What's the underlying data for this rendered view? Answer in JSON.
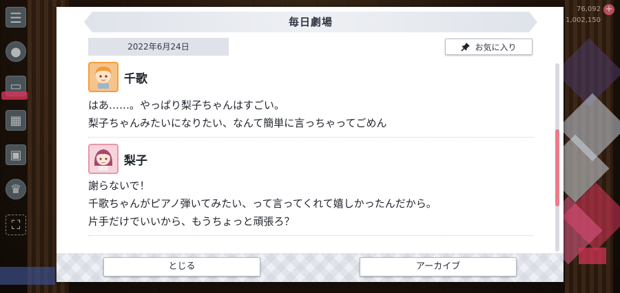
{
  "background": {
    "currency_top": "76,092",
    "currency_bottom": "1,002,150"
  },
  "dialog": {
    "title": "毎日劇場",
    "date": "2022年6月24日",
    "favorite_label": "お気に入り",
    "entries": [
      {
        "speaker": "千歌",
        "avatar": "chika-avatar-icon",
        "lines": [
          "はあ……。やっぱり梨子ちゃんはすごい。",
          "梨子ちゃんみたいになりたい、なんて簡単に言っちゃってごめん"
        ]
      },
      {
        "speaker": "梨子",
        "avatar": "riko-avatar-icon",
        "lines": [
          "謝らないで！",
          "千歌ちゃんがピアノ弾いてみたい、って言ってくれて嬉しかったんだから。",
          "片手だけでいいから、もうちょっと頑張ろ？"
        ]
      }
    ],
    "buttons": {
      "close_label": "とじる",
      "archive_label": "アーカイブ"
    },
    "scroll_position": 0.59
  },
  "colors": {
    "accent_pink": "#ec7a8b",
    "title_bar": "#dfe3ea",
    "date_bg": "#e0e2ea"
  }
}
